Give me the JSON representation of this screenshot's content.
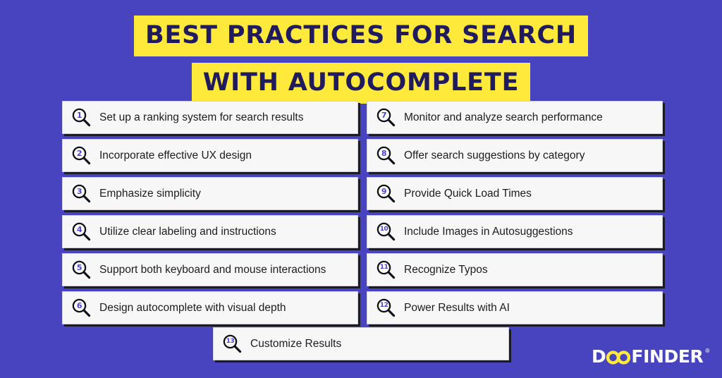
{
  "background_color": "#4844c0",
  "accent_yellow": "#ffe93a",
  "title": {
    "line1": "BEST PRACTICES FOR SEARCH",
    "line2": "WITH AUTOCOMPLETE"
  },
  "columns": {
    "left": [
      {
        "number": "1",
        "label": "Set up a ranking system for search results"
      },
      {
        "number": "2",
        "label": "Incorporate effective UX design"
      },
      {
        "number": "3",
        "label": "Emphasize simplicity"
      },
      {
        "number": "4",
        "label": "Utilize clear labeling and instructions"
      },
      {
        "number": "5",
        "label": "Support both keyboard and mouse interactions"
      },
      {
        "number": "6",
        "label": "Design autocomplete with visual depth"
      }
    ],
    "right": [
      {
        "number": "7",
        "label": "Monitor and analyze search performance"
      },
      {
        "number": "8",
        "label": "Offer search suggestions by category"
      },
      {
        "number": "9",
        "label": "Provide Quick Load Times"
      },
      {
        "number": "10",
        "label": "Include Images in Autosuggestions"
      },
      {
        "number": "11",
        "label": "Recognize Typos"
      },
      {
        "number": "12",
        "label": "Power Results with AI"
      }
    ],
    "bottom": [
      {
        "number": "13",
        "label": "Customize Results"
      }
    ]
  },
  "logo": {
    "part1": "D",
    "oo": "OO",
    "part2": "FINDER",
    "registered": "®"
  }
}
